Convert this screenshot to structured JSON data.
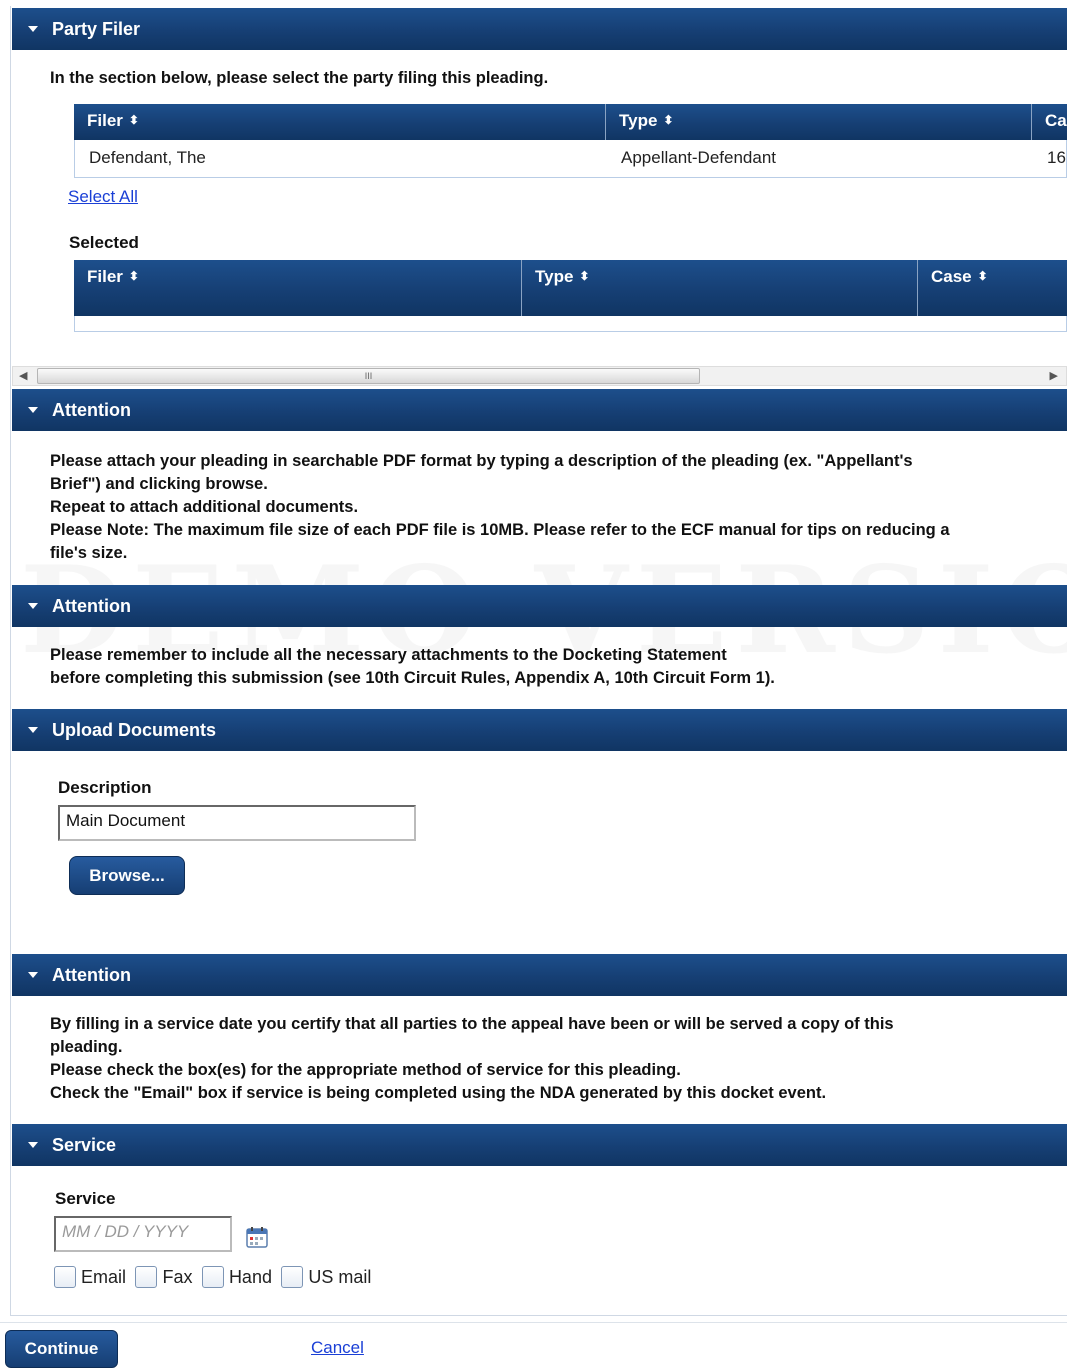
{
  "party_filer": {
    "header": "Party Filer",
    "instruction": "In the section below, please select the party filing this pleading.",
    "available_columns": [
      "Filer",
      "Type",
      "Ca"
    ],
    "available_rows": [
      {
        "filer": "Defendant, The",
        "type": "Appellant-Defendant",
        "case": "16"
      }
    ],
    "select_all": "Select All",
    "selected_label": "Selected",
    "selected_columns": [
      "Filer",
      "Type",
      "Case"
    ]
  },
  "attention1": {
    "header": "Attention",
    "lines": [
      "Please attach your pleading in searchable PDF format by typing a description of the pleading (ex. \"Appellant's",
      "Brief\") and clicking browse.",
      "Repeat to attach additional documents.",
      "Please Note: The maximum file size of each PDF file is 10MB. Please refer to the ECF manual for tips on reducing a",
      "file's size."
    ]
  },
  "watermark": "DEMO VERSION",
  "attention2": {
    "header": "Attention",
    "lines": [
      "Please remember to include all the necessary attachments to the Docketing Statement",
      "before completing this submission (see 10th Circuit Rules, Appendix A, 10th Circuit Form 1)."
    ]
  },
  "upload": {
    "header": "Upload Documents",
    "description_label": "Description",
    "description_value": "Main Document",
    "browse_label": "Browse..."
  },
  "attention3": {
    "header": "Attention",
    "lines": [
      "By filling in a service date you certify that all parties to the appeal have been or will be served a copy of this",
      "pleading.",
      "Please check the box(es) for the appropriate method of service for this pleading.",
      "Check the \"Email\" box if service is being completed using the NDA generated by this docket event."
    ]
  },
  "service": {
    "header": "Service",
    "label": "Service",
    "date_placeholder": "MM / DD / YYYY",
    "calendar_icon": "calendar-icon",
    "options": [
      "Email",
      "Fax",
      "Hand",
      "US mail"
    ]
  },
  "footer": {
    "continue_label": "Continue",
    "cancel_label": "Cancel"
  }
}
